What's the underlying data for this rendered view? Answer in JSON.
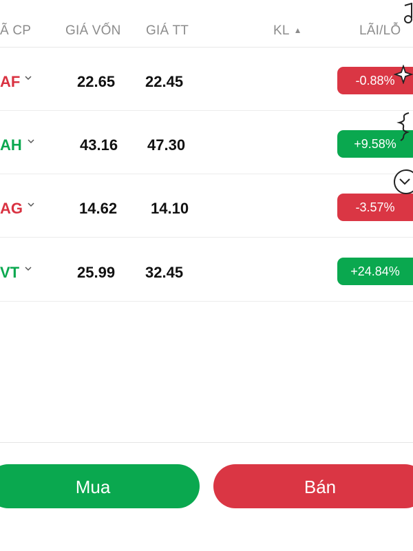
{
  "header": {
    "col_symbol": "Ã CP",
    "col_cost": "GIÁ VỐN",
    "col_market": "GIÁ TT",
    "col_volume": "KL",
    "col_pl": "LÃI/LỖ"
  },
  "holdings": [
    {
      "symbol": "AF",
      "cost": "22.65",
      "market": "22.45",
      "pl": "-0.88%",
      "status": "loss"
    },
    {
      "symbol": "AH",
      "cost": "43.16",
      "market": "47.30",
      "pl": "+9.58%",
      "status": "gain"
    },
    {
      "symbol": "AG",
      "cost": "14.62",
      "market": "14.10",
      "pl": "-3.57%",
      "status": "loss"
    },
    {
      "symbol": "VT",
      "cost": "25.99",
      "market": "32.45",
      "pl": "+24.84%",
      "status": "gain"
    }
  ],
  "actions": {
    "buy_label": "Mua",
    "sell_label": "Bán"
  },
  "colors": {
    "gain": "#0aa84f",
    "loss": "#da3644",
    "header_text": "#8c8c8c"
  },
  "icons": {
    "sort": "sort-updown-icon",
    "row_expand": "chevron-down-icon"
  }
}
